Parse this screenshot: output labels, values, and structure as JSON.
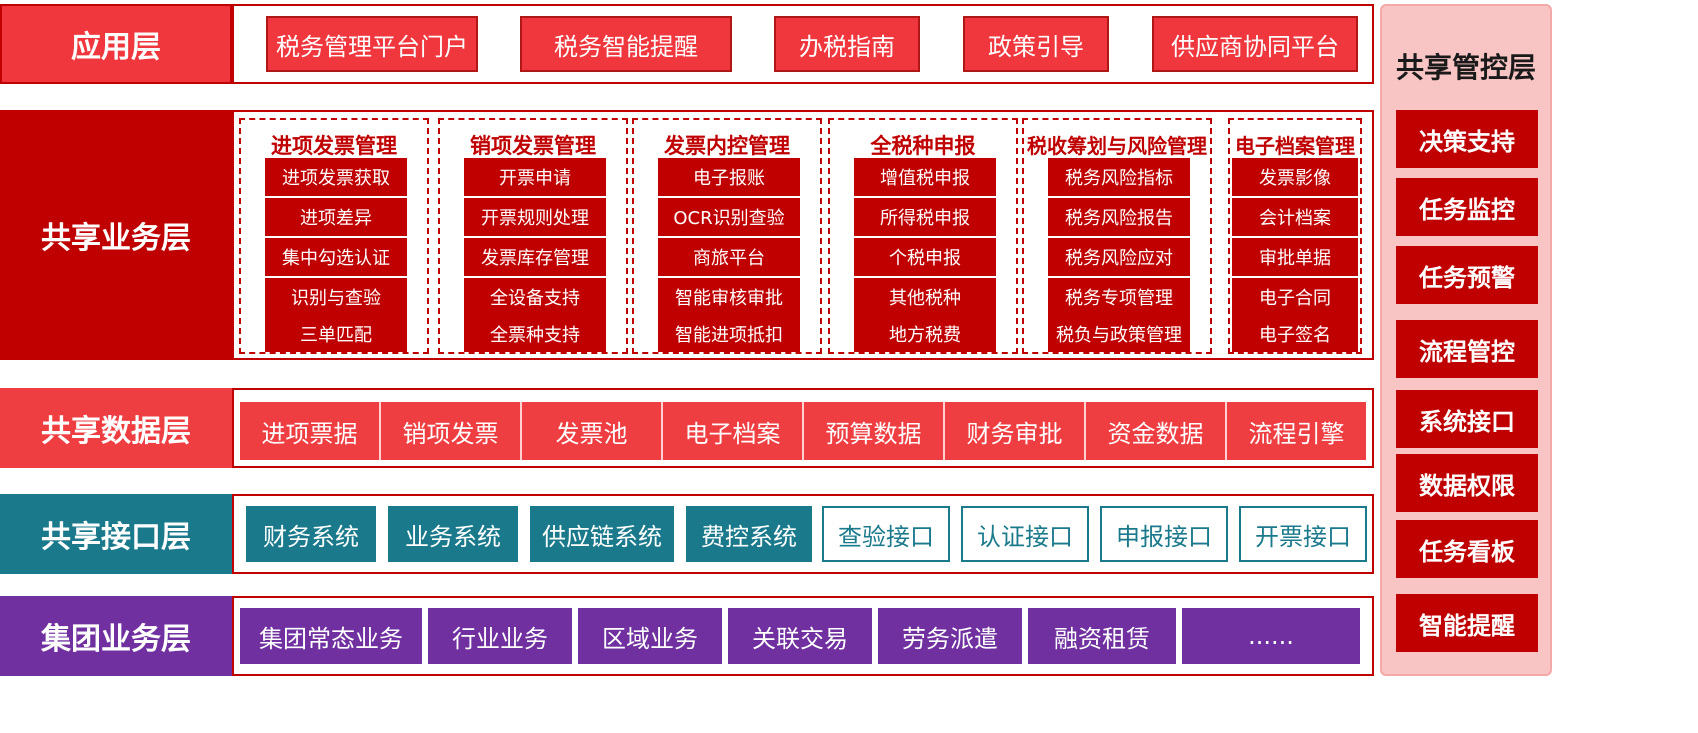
{
  "colors": {
    "app_red": "#f0373d",
    "business_red": "#c00000",
    "data_red": "#ef3e42",
    "interface_teal": "#1a7a8c",
    "group_purple": "#7030a0",
    "side_pink": "#f9c4c4"
  },
  "app_layer": {
    "label": "应用层",
    "items": [
      "税务管理平台门户",
      "税务智能提醒",
      "办税指南",
      "政策引导",
      "供应商协同平台"
    ]
  },
  "business_layer": {
    "label": "共享业务层",
    "groups": [
      {
        "title": "进项发票管理",
        "items": [
          "进项发票获取",
          "进项差异",
          "集中勾选认证",
          "识别与查验",
          "三单匹配"
        ]
      },
      {
        "title": "销项发票管理",
        "items": [
          "开票申请",
          "开票规则处理",
          "发票库存管理",
          "全设备支持",
          "全票种支持"
        ]
      },
      {
        "title": "发票内控管理",
        "items": [
          "电子报账",
          "OCR识别查验",
          "商旅平台",
          "智能审核审批",
          "智能进项抵扣"
        ]
      },
      {
        "title": "全税种申报",
        "items": [
          "增值税申报",
          "所得税申报",
          "个税申报",
          "其他税种",
          "地方税费"
        ]
      },
      {
        "title": "税收筹划与风险管理",
        "items": [
          "税务风险指标",
          "税务风险报告",
          "税务风险应对",
          "税务专项管理",
          "税负与政策管理"
        ]
      },
      {
        "title": "电子档案管理",
        "items": [
          "发票影像",
          "会计档案",
          "审批单据",
          "电子合同",
          "电子签名"
        ]
      }
    ]
  },
  "data_layer": {
    "label": "共享数据层",
    "items": [
      "进项票据",
      "销项发票",
      "发票池",
      "电子档案",
      "预算数据",
      "财务审批",
      "资金数据",
      "流程引擎"
    ]
  },
  "interface_layer": {
    "label": "共享接口层",
    "items": [
      "财务系统",
      "业务系统",
      "供应链系统",
      "费控系统",
      "查验接口",
      "认证接口",
      "申报接口",
      "开票接口"
    ]
  },
  "group_layer": {
    "label": "集团业务层",
    "items": [
      "集团常态业务",
      "行业业务",
      "区域业务",
      "关联交易",
      "劳务派遣",
      "融资租赁",
      "......"
    ]
  },
  "control_layer": {
    "label": "共享管控层",
    "items": [
      "决策支持",
      "任务监控",
      "任务预警",
      "流程管控",
      "系统接口",
      "数据权限",
      "任务看板",
      "智能提醒"
    ]
  }
}
